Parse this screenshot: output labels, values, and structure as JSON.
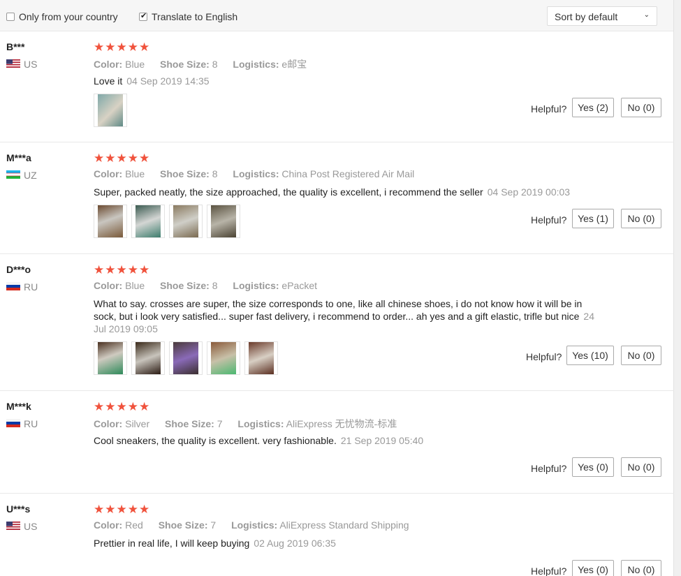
{
  "filters": {
    "only_country_label": "Only from your country",
    "only_country_checked": false,
    "translate_label": "Translate to English",
    "translate_checked": true,
    "sort_label": "Sort by default"
  },
  "colors": {
    "star": "#f0523c",
    "muted": "#999999"
  },
  "helpful_label": "Helpful?",
  "attr_labels": {
    "color": "Color:",
    "shoe_size": "Shoe Size:",
    "logistics": "Logistics:"
  },
  "reviews": [
    {
      "name": "B***",
      "country": "US",
      "stars": "★★★★★",
      "color": "Blue",
      "shoe_size": "8",
      "logistics": "e邮宝",
      "text": "Love it",
      "date": "04 Sep 2019 14:35",
      "yes": "Yes (2)",
      "no": "No (0)"
    },
    {
      "name": "M***a",
      "country": "UZ",
      "stars": "★★★★★",
      "color": "Blue",
      "shoe_size": "8",
      "logistics": "China Post Registered Air Mail",
      "text": "Super, packed neatly, the size approached, the quality is excellent, i recommend the seller",
      "date": "04 Sep 2019 00:03",
      "yes": "Yes (1)",
      "no": "No (0)"
    },
    {
      "name": "D***o",
      "country": "RU",
      "stars": "★★★★★",
      "color": "Blue",
      "shoe_size": "8",
      "logistics": "ePacket",
      "text": "What to say. crosses are super, the size corresponds to one, like all chinese shoes, i do not know how it will be in sock, but i look very satisfied... super fast delivery, i recommend to order... ah yes and a gift elastic, trifle but nice",
      "date": "24 Jul 2019 09:05",
      "yes": "Yes (10)",
      "no": "No (0)"
    },
    {
      "name": "M***k",
      "country": "RU",
      "stars": "★★★★★",
      "color": "Silver",
      "shoe_size": "7",
      "logistics": "AliExpress 无忧物流-标准",
      "text": "Cool sneakers, the quality is excellent. very fashionable.",
      "date": "21 Sep 2019 05:40",
      "yes": "Yes (0)",
      "no": "No (0)"
    },
    {
      "name": "U***s",
      "country": "US",
      "stars": "★★★★★",
      "color": "Red",
      "shoe_size": "7",
      "logistics": "AliExpress Standard Shipping",
      "text": "Prettier in real life, I will keep buying",
      "date": "02 Aug 2019 06:35",
      "yes": "Yes (0)",
      "no": "No (0)"
    }
  ]
}
